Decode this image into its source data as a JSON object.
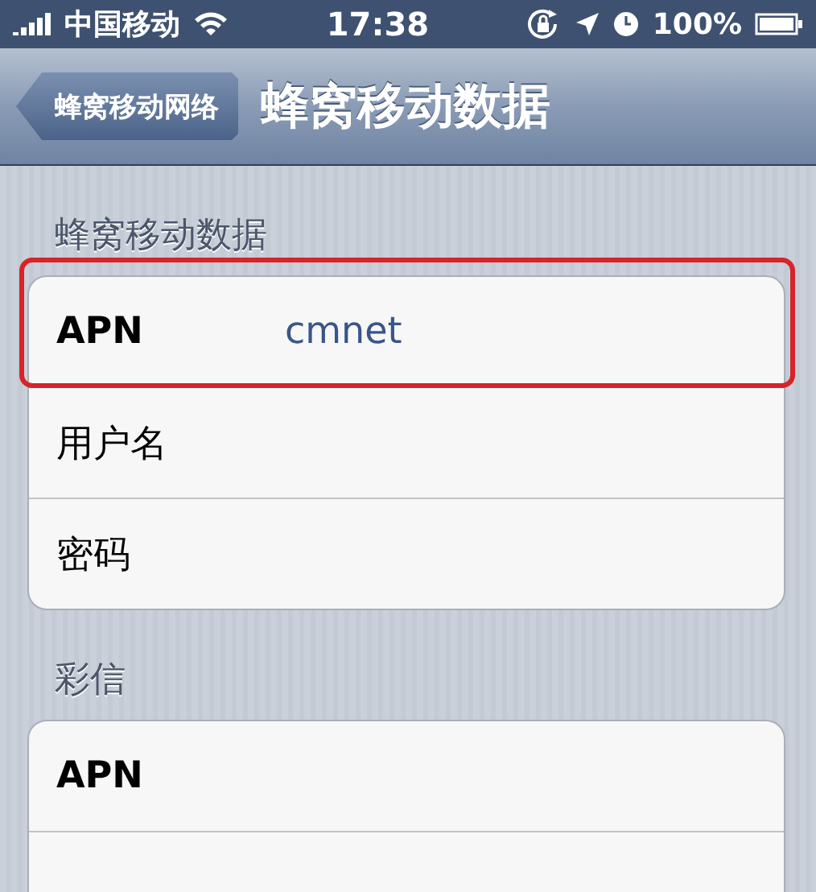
{
  "status_bar": {
    "carrier": "中国移动",
    "time": "17:38",
    "battery": "100%"
  },
  "nav_bar": {
    "back_button": "蜂窝移动网络",
    "title": "蜂窝移动数据"
  },
  "sections": [
    {
      "title": "蜂窝移动数据",
      "rows": [
        {
          "label": "APN",
          "value": "cmnet",
          "highlighted": true
        },
        {
          "label": "用户名",
          "highlighted": false
        },
        {
          "label": "密码",
          "highlighted": false
        }
      ]
    },
    {
      "title": "彩信",
      "rows": [
        {
          "label": "APN",
          "highlighted": false
        }
      ]
    }
  ]
}
